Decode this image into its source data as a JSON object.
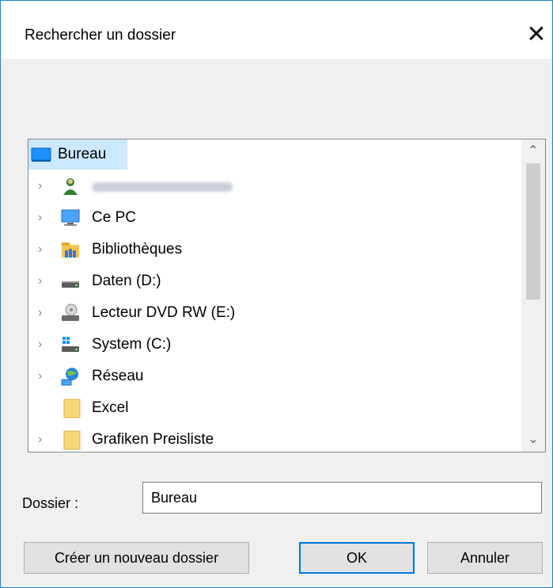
{
  "dialog": {
    "title": "Rechercher un dossier",
    "close_glyph": "✕"
  },
  "tree": {
    "items": [
      {
        "label": "Bureau",
        "icon": "desktop-icon",
        "expandable": false,
        "selected": true
      },
      {
        "label": "",
        "icon": "user-icon",
        "expandable": true,
        "redacted": true
      },
      {
        "label": "Ce PC",
        "icon": "computer-icon",
        "expandable": true
      },
      {
        "label": "Bibliothèques",
        "icon": "libraries-icon",
        "expandable": true
      },
      {
        "label": "Daten (D:)",
        "icon": "drive-icon",
        "expandable": true
      },
      {
        "label": "Lecteur DVD RW (E:)",
        "icon": "dvd-drive-icon",
        "expandable": true
      },
      {
        "label": "System (C:)",
        "icon": "system-drive-icon",
        "expandable": true
      },
      {
        "label": "Réseau",
        "icon": "network-icon",
        "expandable": true
      },
      {
        "label": "Excel",
        "icon": "folder-icon",
        "expandable": false
      },
      {
        "label": "Grafiken Preisliste",
        "icon": "folder-icon",
        "expandable": true
      }
    ]
  },
  "folder": {
    "label": "Dossier :",
    "value": "Bureau"
  },
  "buttons": {
    "new_folder": "Créer un nouveau dossier",
    "ok": "OK",
    "cancel": "Annuler"
  },
  "colors": {
    "accent": "#0078d7",
    "selection": "#cce8ff",
    "dialog_bg": "#f0f0f0"
  }
}
